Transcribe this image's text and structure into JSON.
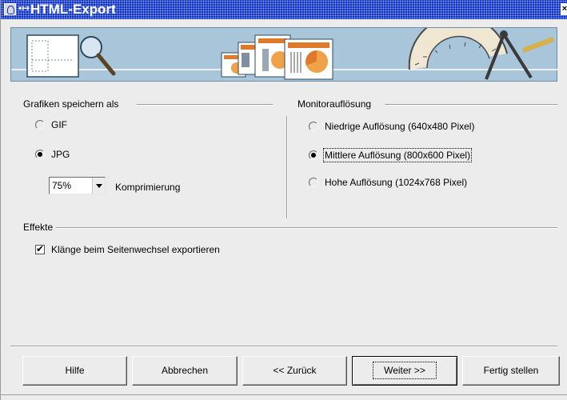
{
  "window": {
    "title": "HTML-Export",
    "menu_glyph": "•↦",
    "close_glyph": "×"
  },
  "grafiken": {
    "heading": "Grafiken speichern als",
    "options": [
      {
        "label": "GIF",
        "checked": false
      },
      {
        "label": "JPG",
        "checked": true
      }
    ],
    "compression": {
      "value": "75%",
      "label": "Komprimierung"
    }
  },
  "monitor": {
    "heading": "Monitorauflösung",
    "options": [
      {
        "label": "Niedrige Auflösung (640x480 Pixel)",
        "checked": false
      },
      {
        "label": "Mittlere Auflösung (800x600 Pixel)",
        "checked": true
      },
      {
        "label": "Hohe Auflösung (1024x768 Pixel)",
        "checked": false
      }
    ]
  },
  "effekte": {
    "heading": "Effekte",
    "checkbox": {
      "label": "Klänge beim Seitenwechsel exportieren",
      "checked": true
    }
  },
  "buttons": {
    "help": "Hilfe",
    "cancel": "Abbrechen",
    "back": "<< Zurück",
    "next": "Weiter >>",
    "finish": "Fertig stellen"
  },
  "colors": {
    "titlebar": "#0a2fc2",
    "banner": "#a9c5d9",
    "dialog_bg": "#ececec"
  }
}
